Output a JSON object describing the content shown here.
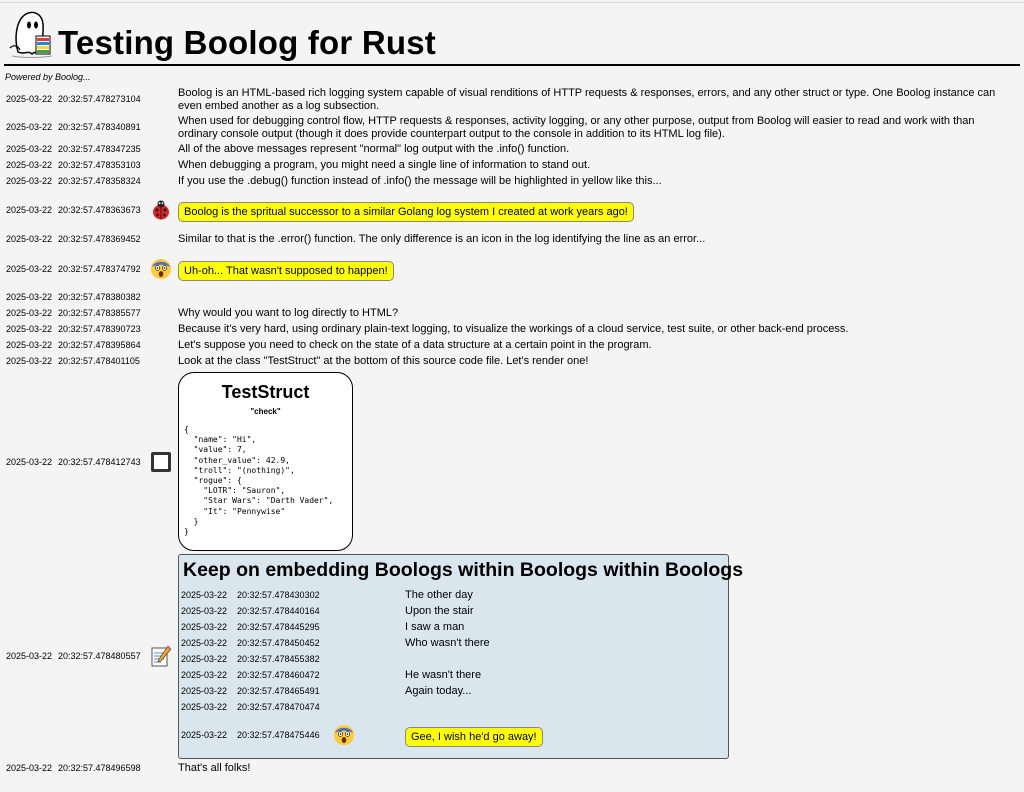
{
  "header": {
    "title": "Testing Boolog for Rust",
    "powered_by": "Powered by Boolog..."
  },
  "entries": [
    {
      "date": "2025-03-22",
      "time": "20:32:57.478273104",
      "text": "Boolog is an HTML-based rich logging system capable of visual renditions of HTTP requests & responses, errors, and any other struct or type. One Boolog instance can even embed another as a log subsection."
    },
    {
      "date": "2025-03-22",
      "time": "20:32:57.478340891",
      "text": "When used for debugging control flow, HTTP requests & responses, activity logging, or any other purpose, output from Boolog will easier to read and work with than ordinary console output (though it does provide counterpart output to the console in addition to its HTML log file)."
    },
    {
      "date": "2025-03-22",
      "time": "20:32:57.478347235",
      "text": "All of the above messages represent \"normal\" log output with the .info() function."
    },
    {
      "date": "2025-03-22",
      "time": "20:32:57.478353103",
      "text": "When debugging a program, you might need a single line of information to stand out."
    },
    {
      "date": "2025-03-22",
      "time": "20:32:57.478358324",
      "text": "If you use the .debug() function instead of .info() the message will be highlighted in yellow like this..."
    },
    {
      "date": "2025-03-22",
      "time": "20:32:57.478363673",
      "text": "Boolog is the spritual successor to a similar Golang log system I created at work years ago!",
      "icon": "ladybug-icon"
    },
    {
      "date": "2025-03-22",
      "time": "20:32:57.478369452",
      "text": "Similar to that is the .error() function. The only difference is an icon in the log identifying the line as an error..."
    },
    {
      "date": "2025-03-22",
      "time": "20:32:57.478374792",
      "text": "Uh-oh... That wasn't supposed to happen!",
      "icon": "screaming-face-icon"
    },
    {
      "date": "2025-03-22",
      "time": "20:32:57.478380382",
      "text": ""
    },
    {
      "date": "2025-03-22",
      "time": "20:32:57.478385577",
      "text": "Why would you want to log directly to HTML?"
    },
    {
      "date": "2025-03-22",
      "time": "20:32:57.478390723",
      "text": "Because it's very hard, using ordinary plain-text logging, to visualize the workings of a cloud service, test suite, or other back-end process."
    },
    {
      "date": "2025-03-22",
      "time": "20:32:57.478395864",
      "text": "Let's suppose you need to check on the state of a data structure at a certain point in the program."
    },
    {
      "date": "2025-03-22",
      "time": "20:32:57.478401105",
      "text": "Look at the class \"TestStruct\" at the bottom of this source code file. Let's render one!"
    },
    {
      "date": "2025-03-22",
      "time": "20:32:57.478412743",
      "icon": "struct-box-icon"
    },
    {
      "date": "2025-03-22",
      "time": "20:32:57.478480557",
      "icon": "memo-icon"
    },
    {
      "date": "2025-03-22",
      "time": "20:32:57.478496598",
      "text": "That's all folks!"
    }
  ],
  "struct": {
    "title": "TestStruct",
    "subtitle": "\"check\"",
    "json": "{\n  \"name\": \"Hi\",\n  \"value\": 7,\n  \"other_value\": 42.9,\n  \"troll\": \"(nothing)\",\n  \"rogue\": {\n    \"LOTR\": \"Sauron\",\n    \"Star Wars\": \"Darth Vader\",\n    \"It\": \"Pennywise\"\n  }\n}"
  },
  "embedded": {
    "title": "Keep on embedding Boologs within Boologs within Boologs",
    "entries": [
      {
        "date": "2025-03-22",
        "time": "20:32:57.478430302",
        "text": "The other day"
      },
      {
        "date": "2025-03-22",
        "time": "20:32:57.478440164",
        "text": "Upon the stair"
      },
      {
        "date": "2025-03-22",
        "time": "20:32:57.478445295",
        "text": "I saw a man"
      },
      {
        "date": "2025-03-22",
        "time": "20:32:57.478450452",
        "text": "Who wasn't there"
      },
      {
        "date": "2025-03-22",
        "time": "20:32:57.478455382",
        "text": ""
      },
      {
        "date": "2025-03-22",
        "time": "20:32:57.478460472",
        "text": "He wasn't there"
      },
      {
        "date": "2025-03-22",
        "time": "20:32:57.478465491",
        "text": "Again today..."
      },
      {
        "date": "2025-03-22",
        "time": "20:32:57.478470474",
        "text": ""
      },
      {
        "date": "2025-03-22",
        "time": "20:32:57.478475446",
        "text": "Gee, I wish he'd go away!",
        "icon": "screaming-face-icon"
      }
    ]
  }
}
